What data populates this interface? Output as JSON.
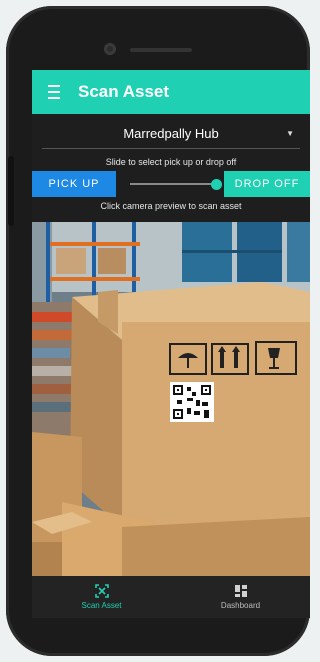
{
  "app": {
    "title": "Scan Asset"
  },
  "hub_selector": {
    "value": "Marredpally Hub"
  },
  "instructions": {
    "slide_hint": "Slide to select pick up or drop off",
    "camera_hint": "Click camera preview to scan asset"
  },
  "mode_toggle": {
    "pick_up_label": "PICK UP",
    "drop_off_label": "DROP OFF",
    "selected": "DROP OFF"
  },
  "bottom_nav": {
    "items": [
      {
        "label": "Scan Asset",
        "icon": "scan-icon",
        "active": true
      },
      {
        "label": "Dashboard",
        "icon": "dashboard-icon",
        "active": false
      }
    ]
  },
  "colors": {
    "accent": "#1fd0b2",
    "pick_up_button": "#1e88e5",
    "background": "#1e1e1e"
  }
}
